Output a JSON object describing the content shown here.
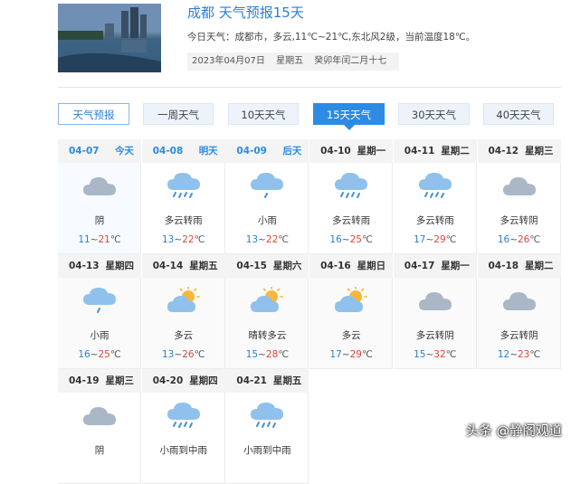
{
  "header": {
    "title": "成都 天气预报15天",
    "summary": "今日天气：成都市，多云,11℃~21℃,东北风2级，当前温度18℃。",
    "date": "2023年04月07日",
    "weekday": "星期五",
    "lunar": "癸卯年闰二月十七"
  },
  "tabs": [
    {
      "label": "天气预报"
    },
    {
      "label": "一周天气"
    },
    {
      "label": "10天天气"
    },
    {
      "label": "15天天气"
    },
    {
      "label": "30天天气"
    },
    {
      "label": "40天天气"
    }
  ],
  "active_tab": "15天天气",
  "days": [
    {
      "date": "04-07",
      "week": "今天",
      "icon": "cloud-icon",
      "desc": "阴",
      "low": "11",
      "high": "21"
    },
    {
      "date": "04-08",
      "week": "明天",
      "icon": "rain-icon",
      "desc": "多云转雨",
      "low": "13",
      "high": "22"
    },
    {
      "date": "04-09",
      "week": "后天",
      "icon": "light-rain-icon",
      "desc": "小雨",
      "low": "13",
      "high": "22"
    },
    {
      "date": "04-10",
      "week": "星期一",
      "icon": "rain-icon",
      "desc": "多云转雨",
      "low": "16",
      "high": "25"
    },
    {
      "date": "04-11",
      "week": "星期二",
      "icon": "rain-icon",
      "desc": "多云转雨",
      "low": "17",
      "high": "29"
    },
    {
      "date": "04-12",
      "week": "星期三",
      "icon": "cloud-icon",
      "desc": "多云转阴",
      "low": "16",
      "high": "26"
    },
    {
      "date": "04-13",
      "week": "星期四",
      "icon": "light-rain-icon",
      "desc": "小雨",
      "low": "16",
      "high": "25"
    },
    {
      "date": "04-14",
      "week": "星期五",
      "icon": "partly-cloudy-icon",
      "desc": "多云",
      "low": "13",
      "high": "26"
    },
    {
      "date": "04-15",
      "week": "星期六",
      "icon": "partly-cloudy-icon",
      "desc": "晴转多云",
      "low": "15",
      "high": "28"
    },
    {
      "date": "04-16",
      "week": "星期日",
      "icon": "partly-cloudy-icon",
      "desc": "多云",
      "low": "17",
      "high": "29"
    },
    {
      "date": "04-17",
      "week": "星期一",
      "icon": "cloud-icon",
      "desc": "多云转阴",
      "low": "15",
      "high": "32"
    },
    {
      "date": "04-18",
      "week": "星期二",
      "icon": "cloud-icon",
      "desc": "多云转阴",
      "low": "12",
      "high": "23"
    },
    {
      "date": "04-19",
      "week": "星期三",
      "icon": "cloud-icon",
      "desc": "阴",
      "low": "",
      "high": ""
    },
    {
      "date": "04-20",
      "week": "星期四",
      "icon": "rain-icon",
      "desc": "小雨到中雨",
      "low": "",
      "high": ""
    },
    {
      "date": "04-21",
      "week": "星期五",
      "icon": "rain-icon",
      "desc": "小雨到中雨",
      "low": "",
      "high": ""
    }
  ],
  "watermark": "头条 @静阁观道",
  "colors": {
    "accent": "#2d8be3",
    "low_temp": "#2d7fd1",
    "high_temp": "#e0463c",
    "cloud": "#9aaec4",
    "sun": "#f6b73c"
  }
}
